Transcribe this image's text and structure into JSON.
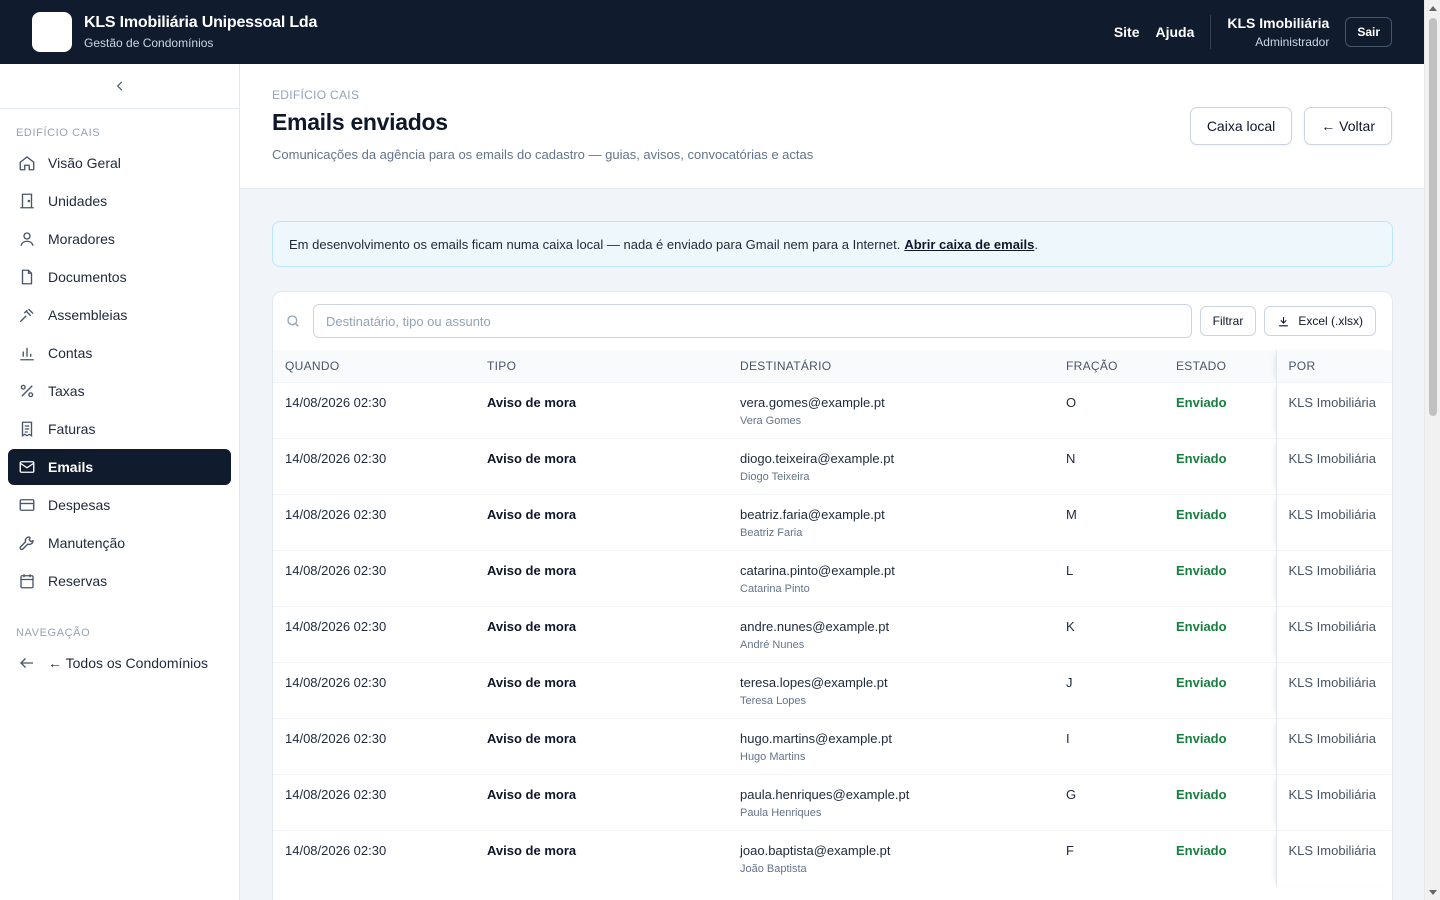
{
  "header": {
    "brand_name": "KLS Imobiliária Unipessoal Lda",
    "brand_sub": "Gestão de Condomínios",
    "links": [
      "Site",
      "Ajuda"
    ],
    "user_name": "KLS Imobiliária",
    "user_role": "Administrador",
    "logout_label": "Sair"
  },
  "sidebar": {
    "section_building": "EDIFÍCIO CAIS",
    "items": [
      {
        "label": "Visão Geral",
        "icon": "home-icon"
      },
      {
        "label": "Unidades",
        "icon": "door-icon"
      },
      {
        "label": "Moradores",
        "icon": "user-icon"
      },
      {
        "label": "Documentos",
        "icon": "file-icon"
      },
      {
        "label": "Assembleias",
        "icon": "gavel-icon"
      },
      {
        "label": "Contas",
        "icon": "bar-chart-icon"
      },
      {
        "label": "Taxas",
        "icon": "percent-icon"
      },
      {
        "label": "Faturas",
        "icon": "receipt-icon"
      },
      {
        "label": "Emails",
        "icon": "mail-icon",
        "active": true
      },
      {
        "label": "Despesas",
        "icon": "card-icon"
      },
      {
        "label": "Manutenção",
        "icon": "wrench-icon"
      },
      {
        "label": "Reservas",
        "icon": "calendar-icon"
      }
    ],
    "section_nav": "NAVEGAÇÃO",
    "back_label": "← Todos os Condomínios"
  },
  "page": {
    "breadcrumb": "EDIFÍCIO CAIS",
    "title": "Emails enviados",
    "subtitle": "Comunicações da agência para os emails do cadastro — guias, avisos, convocatórias e actas",
    "btn_local": "Caixa local",
    "btn_back": "← Voltar"
  },
  "info": {
    "text": "Em desenvolvimento os emails ficam numa caixa local — nada é enviado para Gmail nem para a Internet.",
    "link": "Abrir caixa de emails",
    "end": "."
  },
  "toolbar": {
    "search_placeholder": "Destinatário, tipo ou assunto",
    "filter_label": "Filtrar",
    "excel_label": "Excel (.xlsx)"
  },
  "table": {
    "columns": [
      "QUANDO",
      "TIPO",
      "DESTINATÁRIO",
      "FRAÇÃO",
      "ESTADO",
      "POR"
    ],
    "rows": [
      {
        "when": "14/08/2026 02:30",
        "type": "Aviso de mora",
        "email": "vera.gomes@example.pt",
        "name": "Vera Gomes",
        "fraction": "O",
        "status": "Enviado",
        "by": "KLS Imobiliária"
      },
      {
        "when": "14/08/2026 02:30",
        "type": "Aviso de mora",
        "email": "diogo.teixeira@example.pt",
        "name": "Diogo Teixeira",
        "fraction": "N",
        "status": "Enviado",
        "by": "KLS Imobiliária"
      },
      {
        "when": "14/08/2026 02:30",
        "type": "Aviso de mora",
        "email": "beatriz.faria@example.pt",
        "name": "Beatriz Faria",
        "fraction": "M",
        "status": "Enviado",
        "by": "KLS Imobiliária"
      },
      {
        "when": "14/08/2026 02:30",
        "type": "Aviso de mora",
        "email": "catarina.pinto@example.pt",
        "name": "Catarina Pinto",
        "fraction": "L",
        "status": "Enviado",
        "by": "KLS Imobiliária"
      },
      {
        "when": "14/08/2026 02:30",
        "type": "Aviso de mora",
        "email": "andre.nunes@example.pt",
        "name": "André Nunes",
        "fraction": "K",
        "status": "Enviado",
        "by": "KLS Imobiliária"
      },
      {
        "when": "14/08/2026 02:30",
        "type": "Aviso de mora",
        "email": "teresa.lopes@example.pt",
        "name": "Teresa Lopes",
        "fraction": "J",
        "status": "Enviado",
        "by": "KLS Imobiliária"
      },
      {
        "when": "14/08/2026 02:30",
        "type": "Aviso de mora",
        "email": "hugo.martins@example.pt",
        "name": "Hugo Martins",
        "fraction": "I",
        "status": "Enviado",
        "by": "KLS Imobiliária"
      },
      {
        "when": "14/08/2026 02:30",
        "type": "Aviso de mora",
        "email": "paula.henriques@example.pt",
        "name": "Paula Henriques",
        "fraction": "G",
        "status": "Enviado",
        "by": "KLS Imobiliária"
      },
      {
        "when": "14/08/2026 02:30",
        "type": "Aviso de mora",
        "email": "joao.baptista@example.pt",
        "name": "João Baptista",
        "fraction": "F",
        "status": "Enviado",
        "by": "KLS Imobiliária"
      }
    ]
  },
  "colors": {
    "topbar": "#111b2e",
    "active_nav": "#111b2e",
    "status_sent": "#15803d",
    "info_bg": "#eef7fc"
  }
}
